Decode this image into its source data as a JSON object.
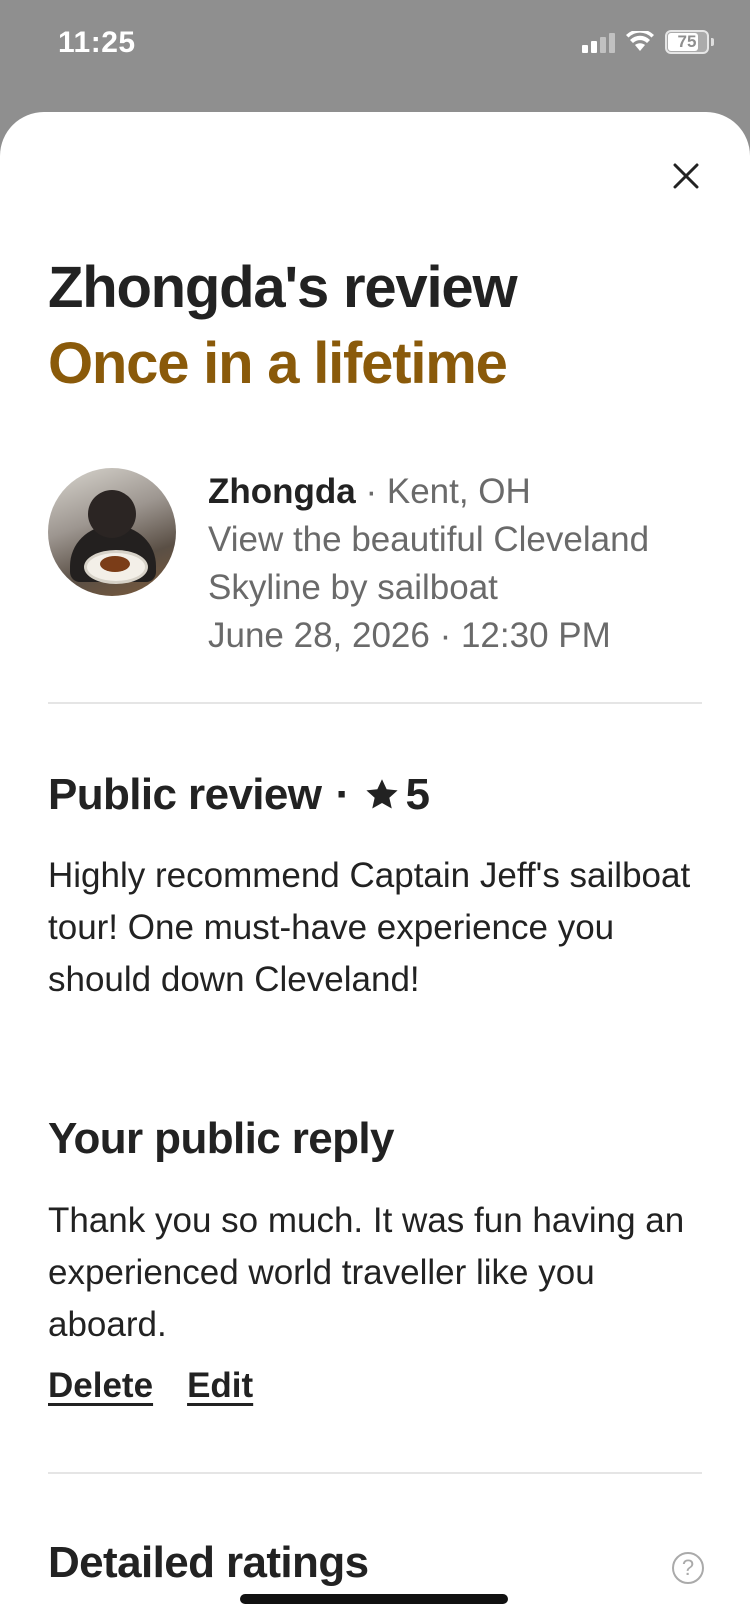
{
  "status_bar": {
    "time": "11:25",
    "battery": "75"
  },
  "header": {
    "title": "Zhongda's review",
    "subtitle": "Once in a lifetime"
  },
  "reviewer": {
    "name": "Zhongda",
    "location": " · Kent, OH",
    "experience": "View the beautiful Cleveland Skyline by sailboat",
    "datetime": "June 28, 2026 · 12:30 PM"
  },
  "public_review": {
    "heading": "Public review",
    "separator": "·",
    "rating": "5",
    "text": "Highly recommend Captain Jeff's sailboat tour! One must-have experience you should down Cleveland!"
  },
  "reply": {
    "heading": "Your public reply",
    "text": "Thank you so much. It was fun having an experienced world traveller like you aboard.",
    "delete_label": "Delete",
    "edit_label": "Edit"
  },
  "detailed": {
    "heading": "Detailed ratings"
  },
  "colors": {
    "accent": "#8a5a0a",
    "text": "#222222",
    "secondary": "#6a6a6a"
  }
}
